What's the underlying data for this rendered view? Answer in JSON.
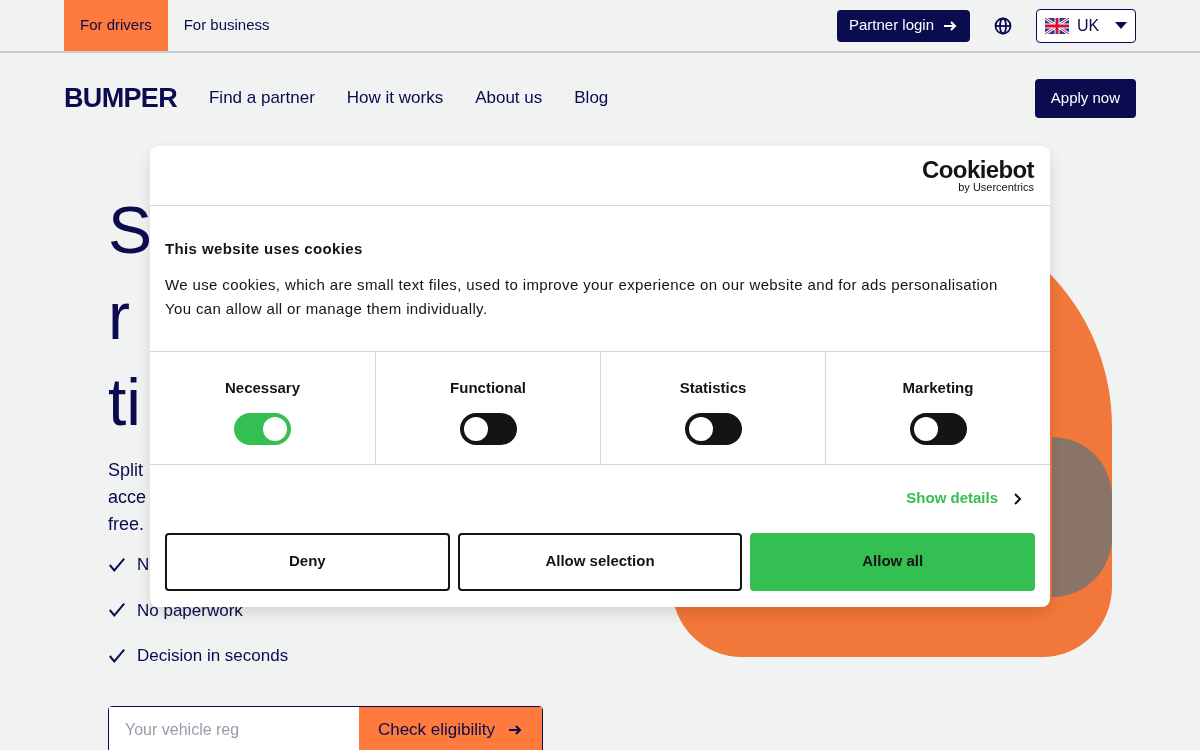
{
  "top_bar": {
    "audience_tabs": [
      {
        "label": "For drivers",
        "selected": true
      },
      {
        "label": "For business",
        "selected": false
      }
    ],
    "partner_login": "Partner login",
    "region": "UK"
  },
  "nav": {
    "logo": "BUMPER",
    "links": [
      "Find a partner",
      "How it works",
      "About us",
      "Blog"
    ],
    "cta": "Apply now"
  },
  "hero": {
    "heading_lines": [
      "S",
      "r",
      "ti"
    ],
    "description_lines": [
      "Split",
      "acce",
      "free."
    ],
    "benefits": [
      "N",
      "No paperwork",
      "Decision in seconds"
    ],
    "reg_field": {
      "placeholder": "Your vehicle reg"
    },
    "check_button": "Check eligibility"
  },
  "cookie_dialog": {
    "logo": {
      "name": "Cookiebot",
      "byline": "by Usercentrics"
    },
    "title": "This website uses cookies",
    "text": "We use cookies, which are small text files, used to improve your experience on our website and for ads personalisation You can allow all or manage them individually.",
    "categories": [
      {
        "label": "Necessary",
        "on": true
      },
      {
        "label": "Functional",
        "on": false
      },
      {
        "label": "Statistics",
        "on": false
      },
      {
        "label": "Marketing",
        "on": false
      }
    ],
    "show_details": "Show details",
    "buttons": [
      {
        "label": "Deny",
        "kind": "outline"
      },
      {
        "label": "Allow selection",
        "kind": "outline"
      },
      {
        "label": "Allow all",
        "kind": "primary"
      }
    ]
  }
}
